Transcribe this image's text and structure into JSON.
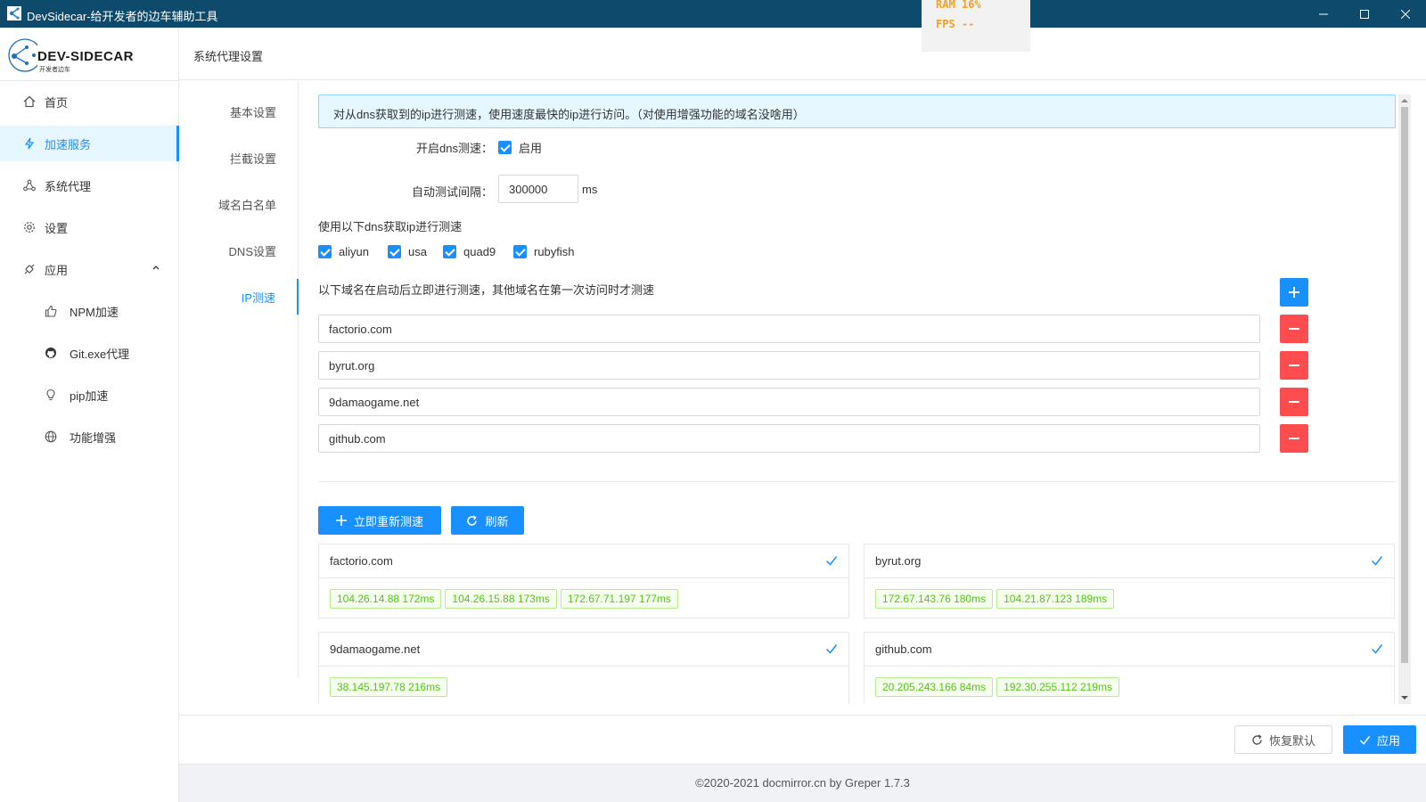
{
  "window": {
    "title": "DevSidecar-给开发者的边车辅助工具"
  },
  "overlay": {
    "ram": "RAM  16%",
    "fps": "FPS --"
  },
  "logo": {
    "text": "DEV-SIDECAR",
    "sub": "开发者边车"
  },
  "sidebar": {
    "items": [
      {
        "label": "首页",
        "icon": "home-icon"
      },
      {
        "label": "加速服务",
        "icon": "thunderbolt-icon",
        "active": true
      },
      {
        "label": "系统代理",
        "icon": "network-icon"
      },
      {
        "label": "设置",
        "icon": "gear-icon"
      },
      {
        "label": "应用",
        "icon": "api-icon",
        "expanded": true
      }
    ],
    "subitems": [
      {
        "label": "NPM加速",
        "icon": "like-icon"
      },
      {
        "label": "Git.exe代理",
        "icon": "github-icon"
      },
      {
        "label": "pip加速",
        "icon": "bulb-icon"
      },
      {
        "label": "功能增强",
        "icon": "globe-icon"
      }
    ]
  },
  "header": {
    "title": "系统代理设置"
  },
  "tabs": [
    {
      "label": "基本设置"
    },
    {
      "label": "拦截设置"
    },
    {
      "label": "域名白名单"
    },
    {
      "label": "DNS设置"
    },
    {
      "label": "IP测速",
      "active": true
    }
  ],
  "content": {
    "alert": "对从dns获取到的ip进行测速，使用速度最快的ip进行访问。（对使用增强功能的域名没啥用）",
    "dns_test_label": "开启dns测速：",
    "dns_test_checkbox": "启用",
    "interval_label": "自动测试间隔：",
    "interval_value": "300000",
    "interval_unit": "ms",
    "dns_list_label": "使用以下dns获取ip进行测速",
    "dns_options": [
      "aliyun",
      "usa",
      "quad9",
      "rubyfish"
    ],
    "domains_label": "以下域名在启动后立即进行测速，其他域名在第一次访问时才测速",
    "domains": [
      "factorio.com",
      "byrut.org",
      "9damaogame.net",
      "github.com"
    ],
    "retest_button": "立即重新测速",
    "refresh_button": "刷新",
    "results": [
      {
        "domain": "factorio.com",
        "ips": [
          "104.26.14.88 172ms",
          "104.26.15.88 173ms",
          "172.67.71.197 177ms"
        ]
      },
      {
        "domain": "byrut.org",
        "ips": [
          "172.67.143.76 180ms",
          "104.21.87.123 189ms"
        ]
      },
      {
        "domain": "9damaogame.net",
        "ips": [
          "38.145.197.78 216ms"
        ]
      },
      {
        "domain": "github.com",
        "ips": [
          "20.205.243.166 84ms",
          "192.30.255.112 219ms"
        ]
      }
    ]
  },
  "actions": {
    "reset": "恢复默认",
    "apply": "应用"
  },
  "footer": {
    "text": "©2020-2021 docmirror.cn by Greper 1.7.3"
  },
  "colors": {
    "primary": "#1890ff",
    "danger": "#ff4d4f",
    "success": "#52c41a",
    "titlebar": "#0e4a6b"
  }
}
